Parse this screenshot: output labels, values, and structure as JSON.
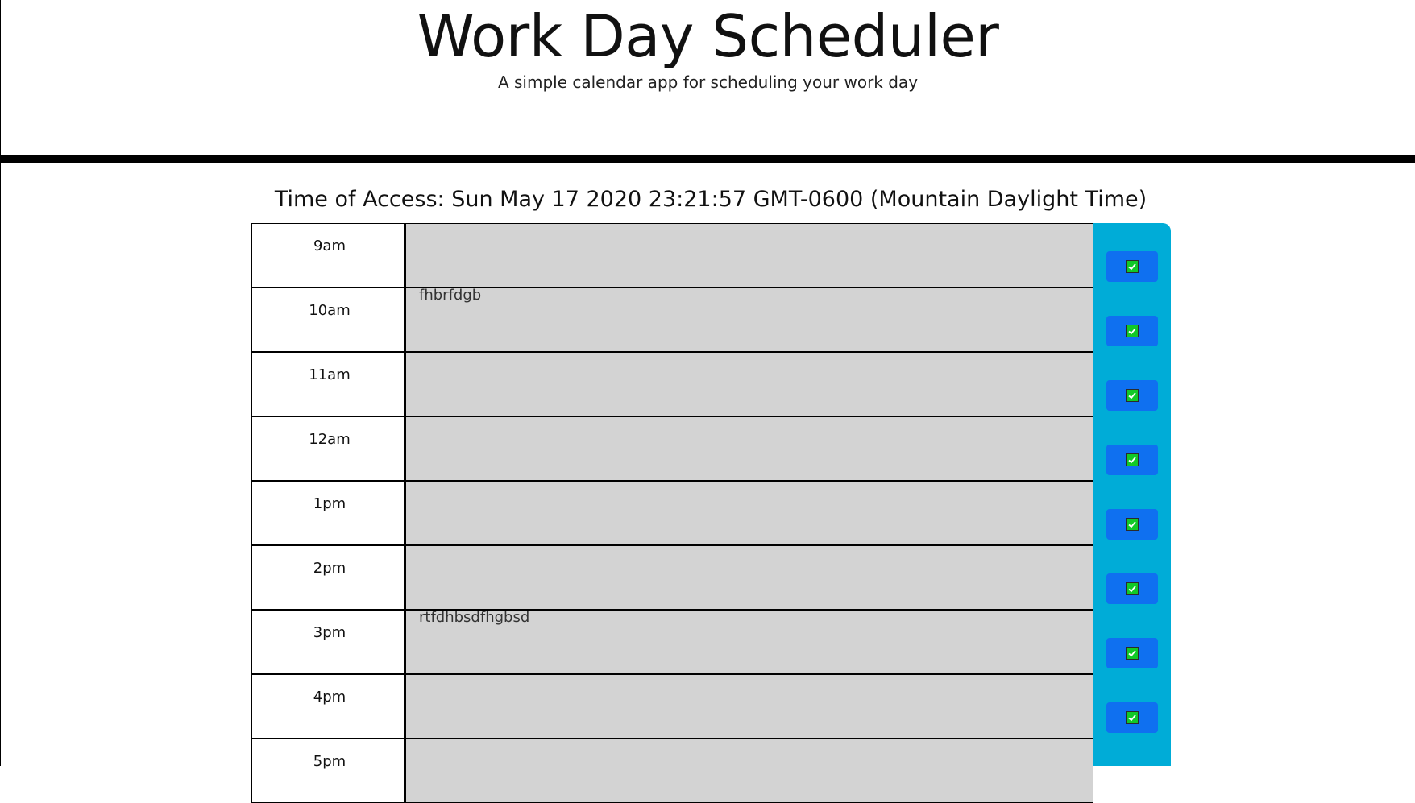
{
  "header": {
    "title": "Work Day Scheduler",
    "subtitle": "A simple calendar app for scheduling your work day"
  },
  "access_time": "Time of Access: Sun May 17 2020 23:21:57 GMT-0600 (Mountain Daylight Time)",
  "rows": [
    {
      "hour": "9am",
      "text": ""
    },
    {
      "hour": "10am",
      "text": "fhbrfdgb"
    },
    {
      "hour": "11am",
      "text": ""
    },
    {
      "hour": "12am",
      "text": ""
    },
    {
      "hour": "1pm",
      "text": ""
    },
    {
      "hour": "2pm",
      "text": ""
    },
    {
      "hour": "3pm",
      "text": "rtfdhbsdfhgbsd"
    },
    {
      "hour": "4pm",
      "text": ""
    },
    {
      "hour": "5pm",
      "text": ""
    }
  ],
  "save_icon": "check-box-icon",
  "colors": {
    "past": "#d3d3d3",
    "save_column": "#00acd7",
    "save_button": "#0f70f0",
    "check": "#11c928"
  }
}
